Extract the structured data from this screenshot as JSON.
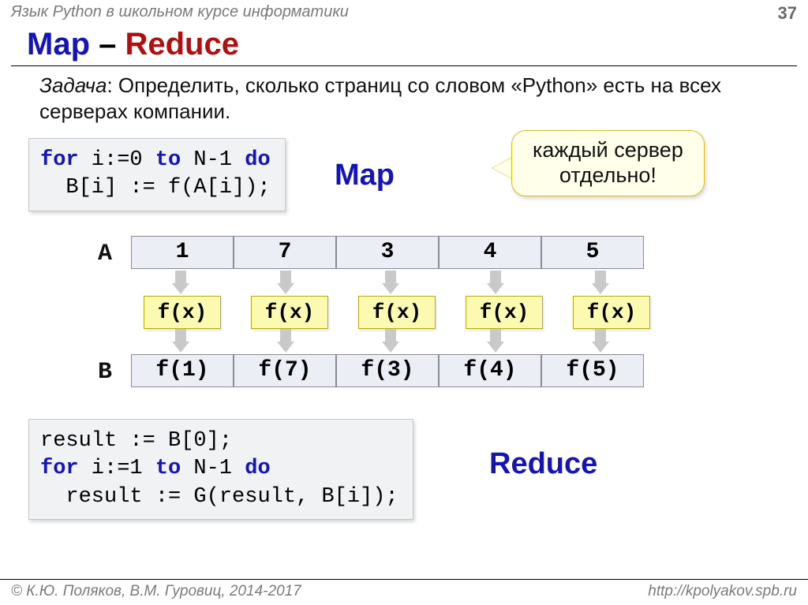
{
  "header": {
    "subject": "Язык Python в школьном курсе информатики",
    "page": "37"
  },
  "title": {
    "map": "Map",
    "dash": " – ",
    "reduce": "Reduce"
  },
  "task": {
    "lead": "Задача",
    "text": ": Определить, сколько страниц со словом «Python» есть на всех серверах компании."
  },
  "code_map": {
    "kw_for": "for",
    "kw_to": "to",
    "kw_do": "do",
    "line1_a": " i:=0 ",
    "line1_b": " N-1 ",
    "line2": "  B[i] := f(A[i]);"
  },
  "labels": {
    "map": "Map",
    "reduce": "Reduce",
    "A": "A",
    "B": "B"
  },
  "callout": {
    "line1": "каждый сервер",
    "line2": "отдельно!"
  },
  "arrays": {
    "A": [
      "1",
      "7",
      "3",
      "4",
      "5"
    ],
    "FX": [
      "f(x)",
      "f(x)",
      "f(x)",
      "f(x)",
      "f(x)"
    ],
    "B": [
      "f(1)",
      "f(7)",
      "f(3)",
      "f(4)",
      "f(5)"
    ]
  },
  "code_reduce": {
    "line1": "result := B[0];",
    "kw_for": "for",
    "kw_to": "to",
    "kw_do": "do",
    "line2_a": " i:=1 ",
    "line2_b": " N-1 ",
    "line3": "  result := G(result, B[i]);"
  },
  "footer": {
    "left": "© К.Ю. Поляков, В.М. Гуровиц, 2014-2017",
    "right": "http://kpolyakov.spb.ru"
  }
}
